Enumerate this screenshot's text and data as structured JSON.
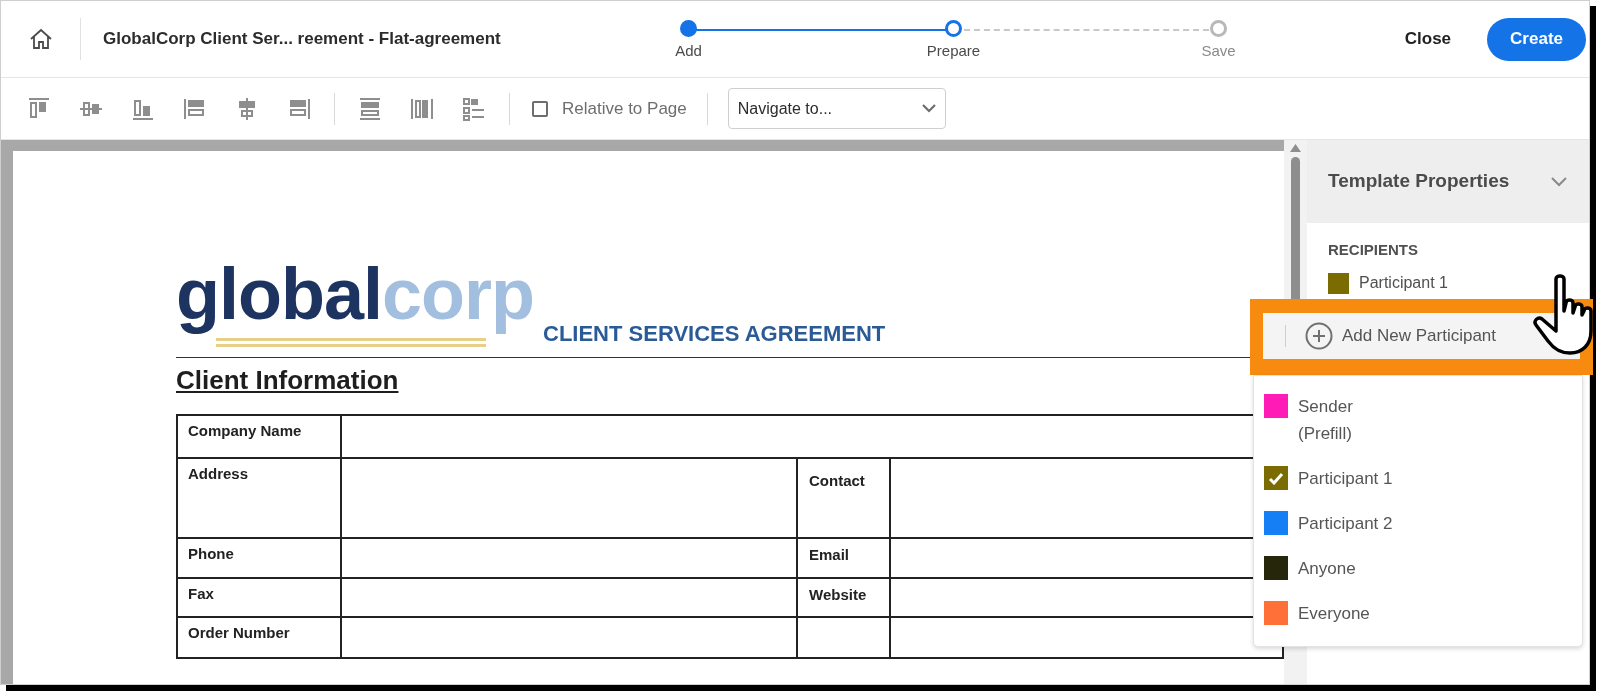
{
  "header": {
    "title": "GlobalCorp Client Ser... reement - Flat-agreement",
    "steps": [
      {
        "label": "Add",
        "completed": true,
        "selected": false
      },
      {
        "label": "Prepare",
        "completed": false,
        "selected": true
      },
      {
        "label": "Save",
        "completed": false,
        "selected": false
      }
    ],
    "close": "Close",
    "create": "Create"
  },
  "toolbar": {
    "relative_to_page": {
      "label": "Relative to Page",
      "checked": false
    },
    "navigate": {
      "value": "Navigate to..."
    }
  },
  "document": {
    "logo": {
      "dark": "global",
      "light": "corp"
    },
    "heading": "CLIENT SERVICES AGREEMENT",
    "section": "Client Information",
    "rows": [
      {
        "cells": [
          "Company Name"
        ]
      },
      {
        "cells": [
          "Address",
          "Contact"
        ]
      },
      {
        "cells": [
          "Phone",
          "Email"
        ]
      },
      {
        "cells": [
          "Fax",
          "Website"
        ]
      },
      {
        "cells": [
          "Order Number"
        ]
      }
    ]
  },
  "panel": {
    "title": "Template Properties",
    "recipients_label": "RECIPIENTS",
    "recipients": [
      {
        "name": "Participant 1",
        "color": "#7a6c00"
      }
    ]
  },
  "menu": {
    "add": "Add New Participant",
    "items": [
      {
        "label": "Sender (Prefill)",
        "color": "#ff1cb6",
        "selected": false
      },
      {
        "label": "Participant 1",
        "color": "#7a6c00",
        "selected": true
      },
      {
        "label": "Participant 2",
        "color": "#1580f5",
        "selected": false
      },
      {
        "label": "Anyone",
        "color": "#26260a",
        "selected": false
      },
      {
        "label": "Everyone",
        "color": "#ff7038",
        "selected": false
      }
    ]
  }
}
